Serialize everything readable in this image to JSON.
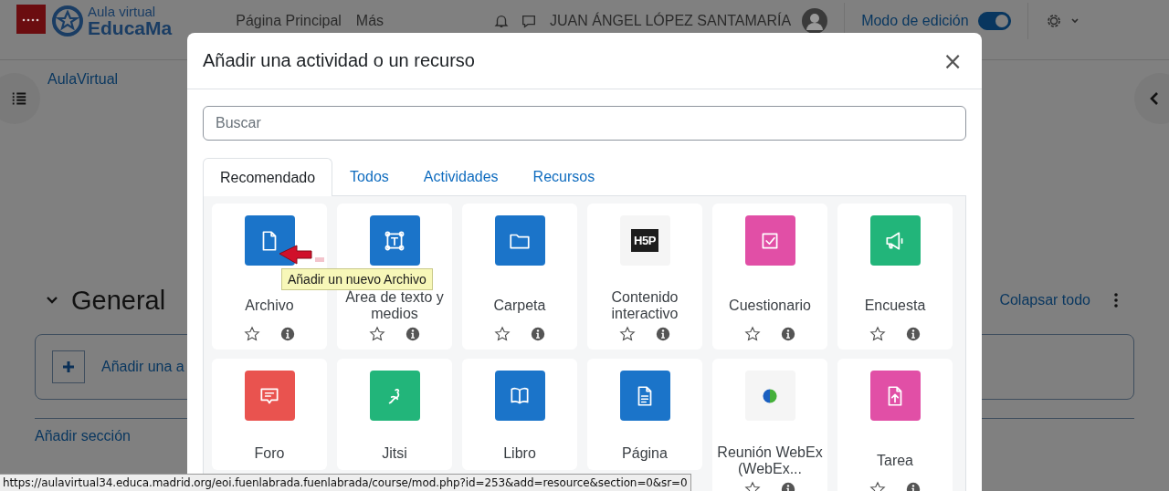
{
  "header": {
    "logo_tagline": "Aula virtual",
    "logo_name": "EducaMa",
    "nav": [
      "Página Principal",
      "Más"
    ],
    "user_name": "JUAN ÁNGEL LÓPEZ SANTAMARÍA",
    "edit_mode": {
      "label": "Modo de edición",
      "on": true
    }
  },
  "breadcrumb": "AulaVirtual",
  "section": {
    "title": "General",
    "collapse_all": "Colapsar todo",
    "add_activity": "Añadir una a",
    "add_section": "Añadir sección"
  },
  "modal": {
    "title": "Añadir una actividad o un recurso",
    "close": "×",
    "search": {
      "placeholder": "Buscar"
    },
    "tabs": [
      {
        "label": "Recomendado",
        "selected": true
      },
      {
        "label": "Todos",
        "selected": false
      },
      {
        "label": "Actividades",
        "selected": false
      },
      {
        "label": "Recursos",
        "selected": false
      }
    ],
    "items": [
      {
        "name": "Archivo",
        "kind": "file",
        "color": "#1b74c9",
        "starred": false
      },
      {
        "name": "Área de texto y medios",
        "kind": "textarea",
        "color": "#1b74c9",
        "starred": false
      },
      {
        "name": "Carpeta",
        "kind": "folder",
        "color": "#1b74c9",
        "starred": false
      },
      {
        "name": "Contenido interactivo",
        "kind": "h5p",
        "logo": "H5P",
        "starred": false
      },
      {
        "name": "Cuestionario",
        "kind": "quiz",
        "color": "#e14fa6",
        "starred": false
      },
      {
        "name": "Encuesta",
        "kind": "survey",
        "color": "#22b57a",
        "starred": false
      },
      {
        "name": "Foro",
        "kind": "forum",
        "color": "#e9534f"
      },
      {
        "name": "Jitsi",
        "kind": "jitsi",
        "color": "#22b57a"
      },
      {
        "name": "Libro",
        "kind": "book",
        "color": "#1b74c9"
      },
      {
        "name": "Página",
        "kind": "page",
        "color": "#1b74c9"
      },
      {
        "name": "Reunión WebEx (WebEx...",
        "kind": "webex",
        "starred": false
      },
      {
        "name": "Tarea",
        "kind": "assign",
        "color": "#e14fa6",
        "starred": false
      }
    ],
    "tooltip": "Añadir un nuevo Archivo"
  },
  "status_url": "https://aulavirtual34.educa.madrid.org/eoi.fuenlabrada.fuenlabrada/course/mod.php?id=253&add=resource&section=0&sr=0"
}
